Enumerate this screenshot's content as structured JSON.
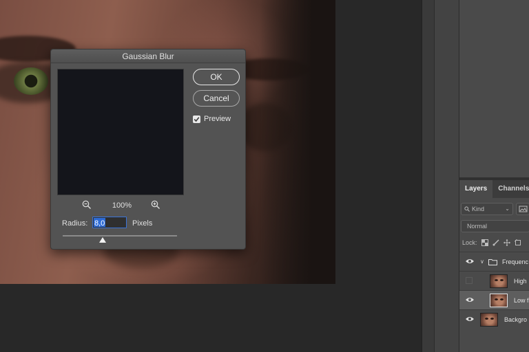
{
  "dialog": {
    "title": "Gaussian Blur",
    "ok_label": "OK",
    "cancel_label": "Cancel",
    "preview_label": "Preview",
    "preview_checked": true,
    "zoom_level": "100%",
    "radius_label": "Radius:",
    "radius_value": "8,0",
    "radius_unit": "Pixels",
    "radius_slider_fraction": 0.35
  },
  "layers_panel": {
    "tabs": [
      {
        "label": "Layers",
        "active": true
      },
      {
        "label": "Channels",
        "active": false
      }
    ],
    "filter_kind": "Kind",
    "blend_mode": "Normal",
    "lock_label": "Lock:",
    "layers": [
      {
        "name": "Frequenc",
        "type": "group",
        "visible": true,
        "selected": false
      },
      {
        "name": "High",
        "type": "layer",
        "visible": false,
        "selected": false
      },
      {
        "name": "Low f",
        "type": "layer",
        "visible": true,
        "selected": true
      },
      {
        "name": "Backgro",
        "type": "layer",
        "visible": true,
        "selected": false
      }
    ]
  },
  "colors": {
    "accent": "#2d6bd6",
    "dialog_bg": "#535353",
    "panel_bg": "#4a4a4a",
    "preview_bg": "#14151b"
  }
}
